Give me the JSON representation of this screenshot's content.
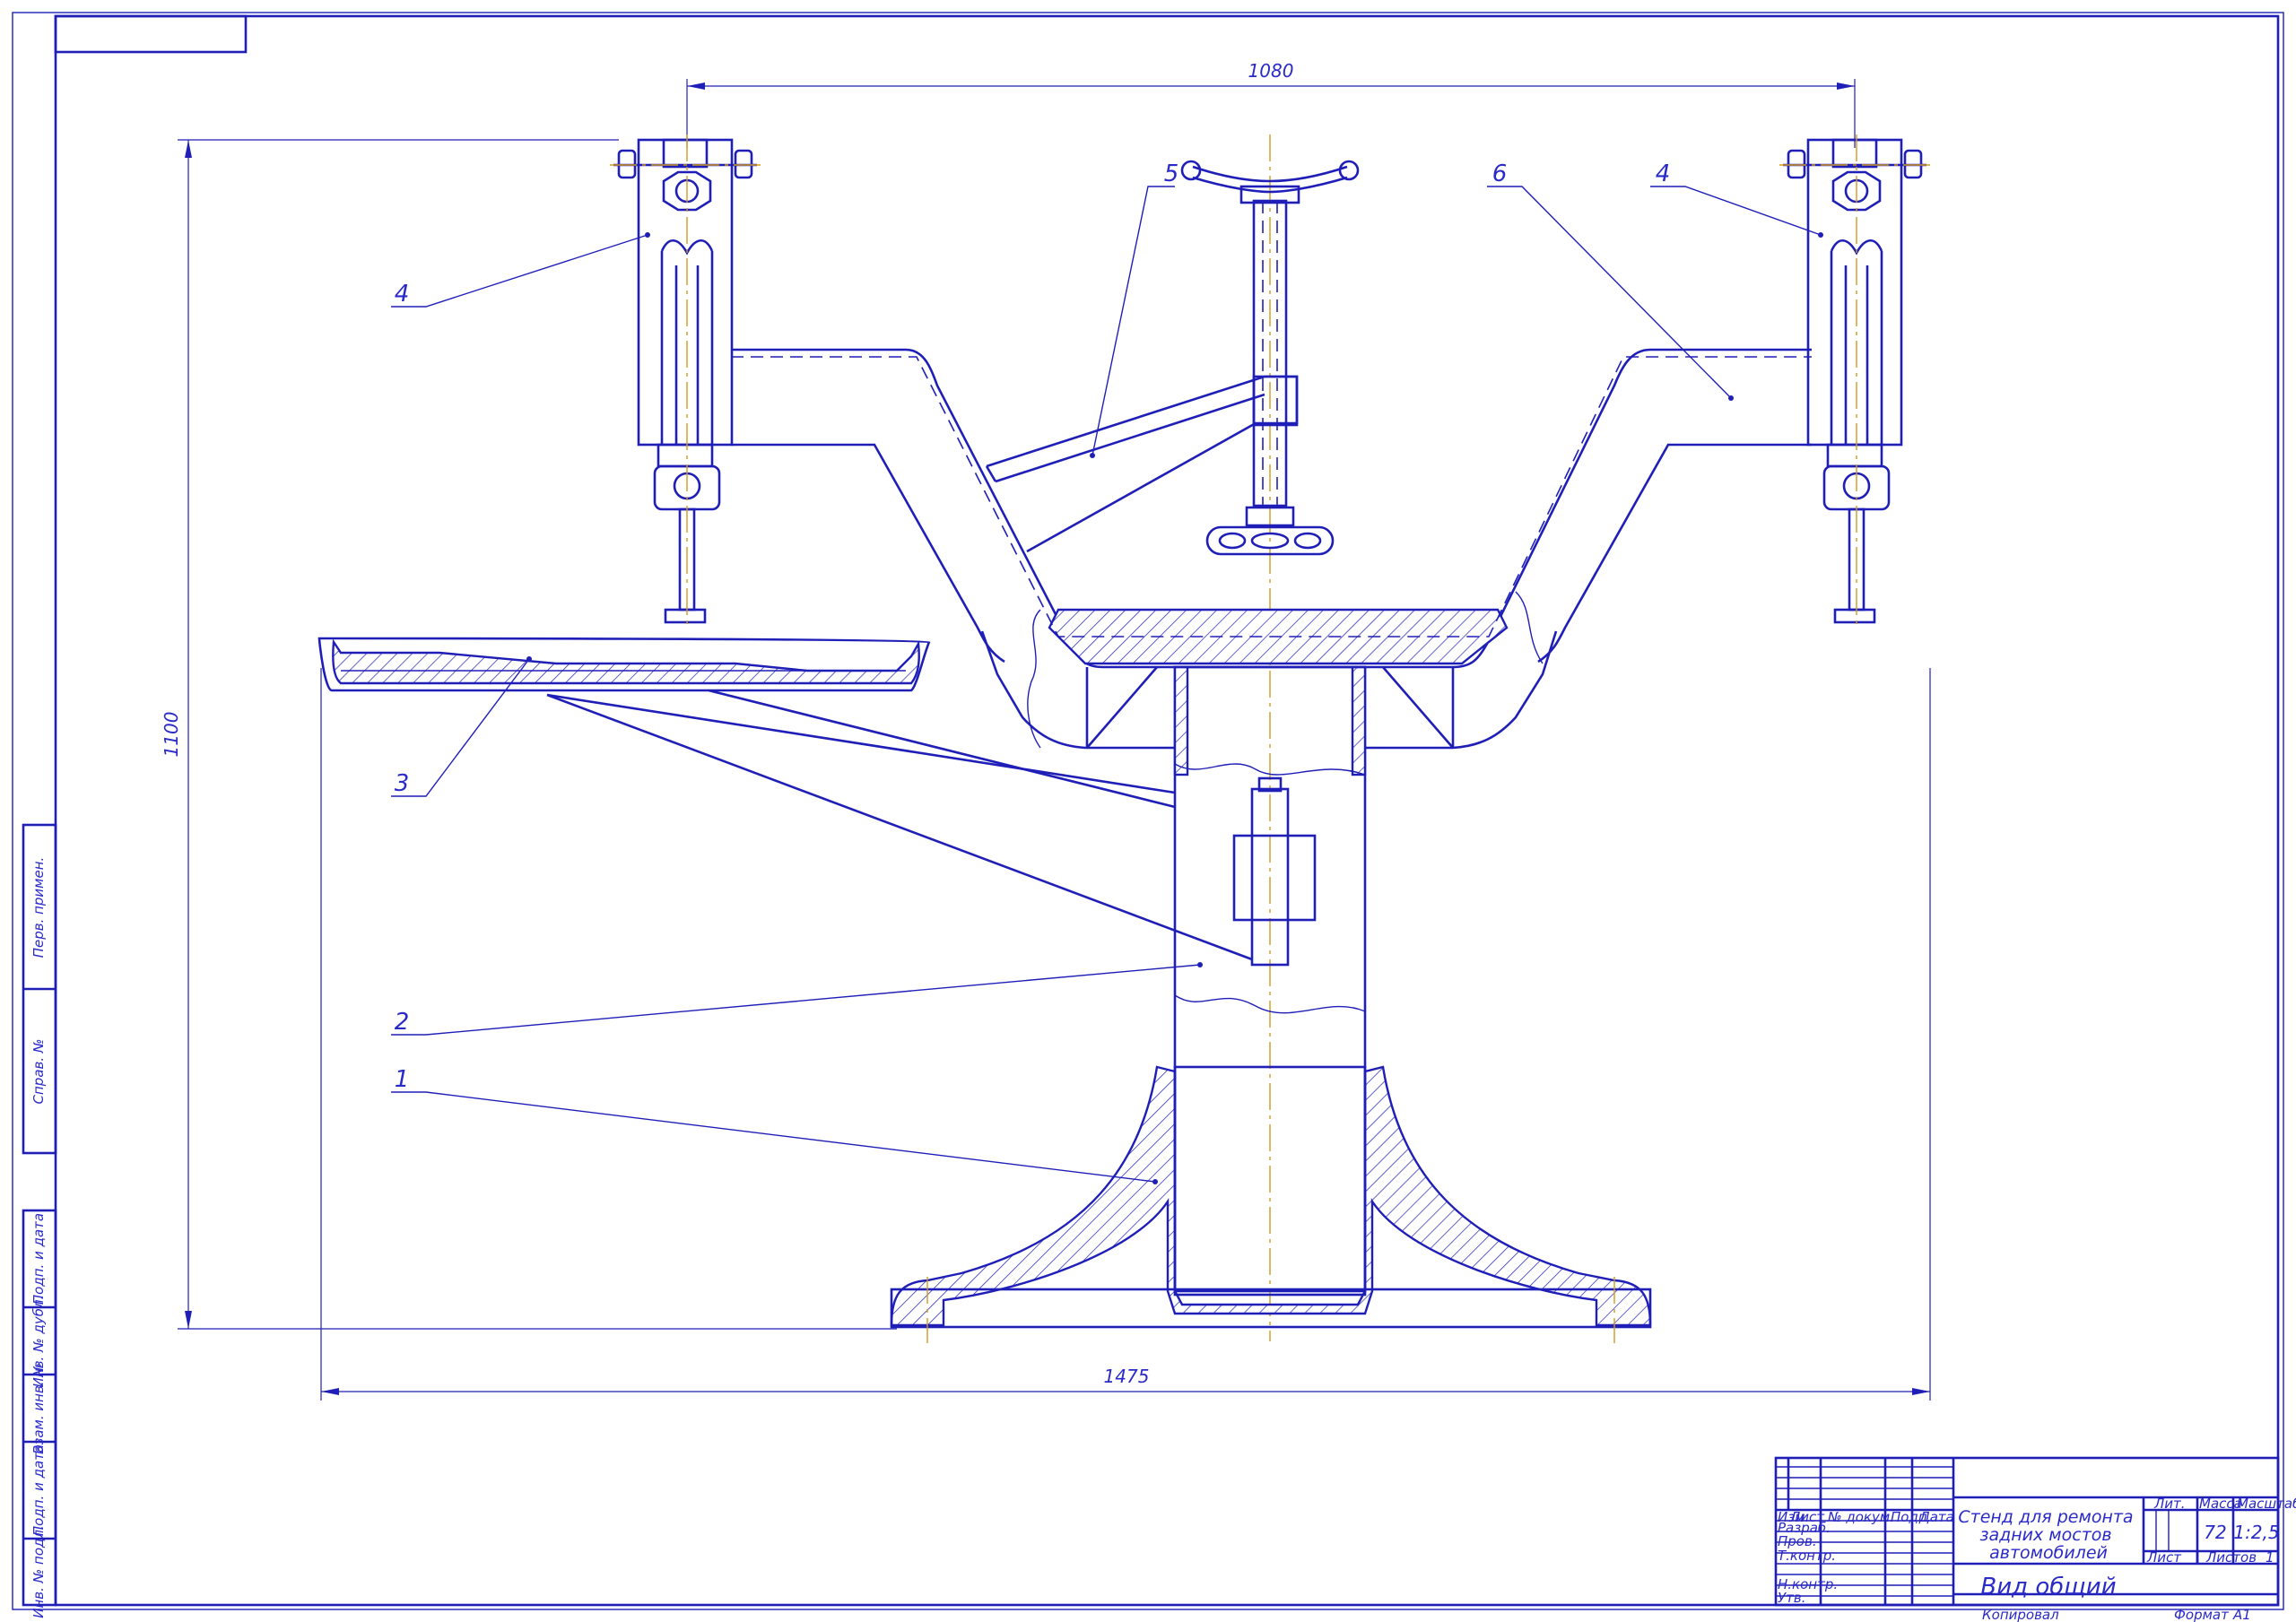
{
  "dimensions": {
    "top_width": "1080",
    "total_height": "1100",
    "bottom_width": "1475"
  },
  "callouts": [
    "1",
    "2",
    "3",
    "4",
    "5",
    "6",
    "4"
  ],
  "side_stamp": [
    "Перв. примен.",
    "Справ. №",
    "Подп. и дата",
    "Инв. № дубл.",
    "Взам. инв. №",
    "Подп. и дата",
    "Инв. № подл."
  ],
  "title_block": {
    "col_headers": [
      "Изм",
      "Лист",
      "№ докум.",
      "Подп.",
      "Дата"
    ],
    "rows": [
      "Разраб.",
      "Пров.",
      "Т.контр.",
      "",
      "Н.контр.",
      "Утв."
    ],
    "title": "Стенд для ремонта задних мостов автомобилей",
    "lit_label": "Лит.",
    "mass_label": "Масса",
    "scale_label": "Масштаб",
    "mass_value": "72",
    "scale_value": "1:2,5",
    "sheet_label": "Лист",
    "sheets_label": "Листов",
    "sheets_value": "1",
    "view_name": "Вид общий",
    "copied": "Копировал",
    "format_label": "Формат",
    "format_value": "A1"
  },
  "colors": {
    "line": "#1f1fb8",
    "axis": "#d09a20",
    "text": "#2a2ac8"
  }
}
